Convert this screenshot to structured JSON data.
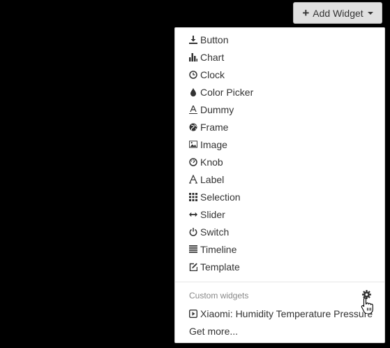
{
  "toolbar": {
    "add_widget_label": "Add Widget",
    "plus_icon": "plus-icon",
    "caret_icon": "caret-down-icon"
  },
  "menu": {
    "items": [
      {
        "label": "Button",
        "icon": "download-icon"
      },
      {
        "label": "Chart",
        "icon": "bar-chart-icon"
      },
      {
        "label": "Clock",
        "icon": "clock-icon"
      },
      {
        "label": "Color Picker",
        "icon": "droplet-icon"
      },
      {
        "label": "Dummy",
        "icon": "text-underline-icon"
      },
      {
        "label": "Frame",
        "icon": "globe-icon"
      },
      {
        "label": "Image",
        "icon": "picture-icon"
      },
      {
        "label": "Knob",
        "icon": "dashboard-icon"
      },
      {
        "label": "Label",
        "icon": "font-icon"
      },
      {
        "label": "Selection",
        "icon": "grid-icon"
      },
      {
        "label": "Slider",
        "icon": "resize-horizontal-icon"
      },
      {
        "label": "Switch",
        "icon": "power-icon"
      },
      {
        "label": "Timeline",
        "icon": "align-justify-icon"
      },
      {
        "label": "Template",
        "icon": "edit-icon"
      }
    ]
  },
  "custom_widgets": {
    "header": "Custom widgets",
    "settings_icon": "gear-icon",
    "items": [
      {
        "label": "Xiaomi: Humidity Temperature Pressure",
        "icon": "play-square-icon"
      }
    ],
    "get_more_label": "Get more..."
  }
}
